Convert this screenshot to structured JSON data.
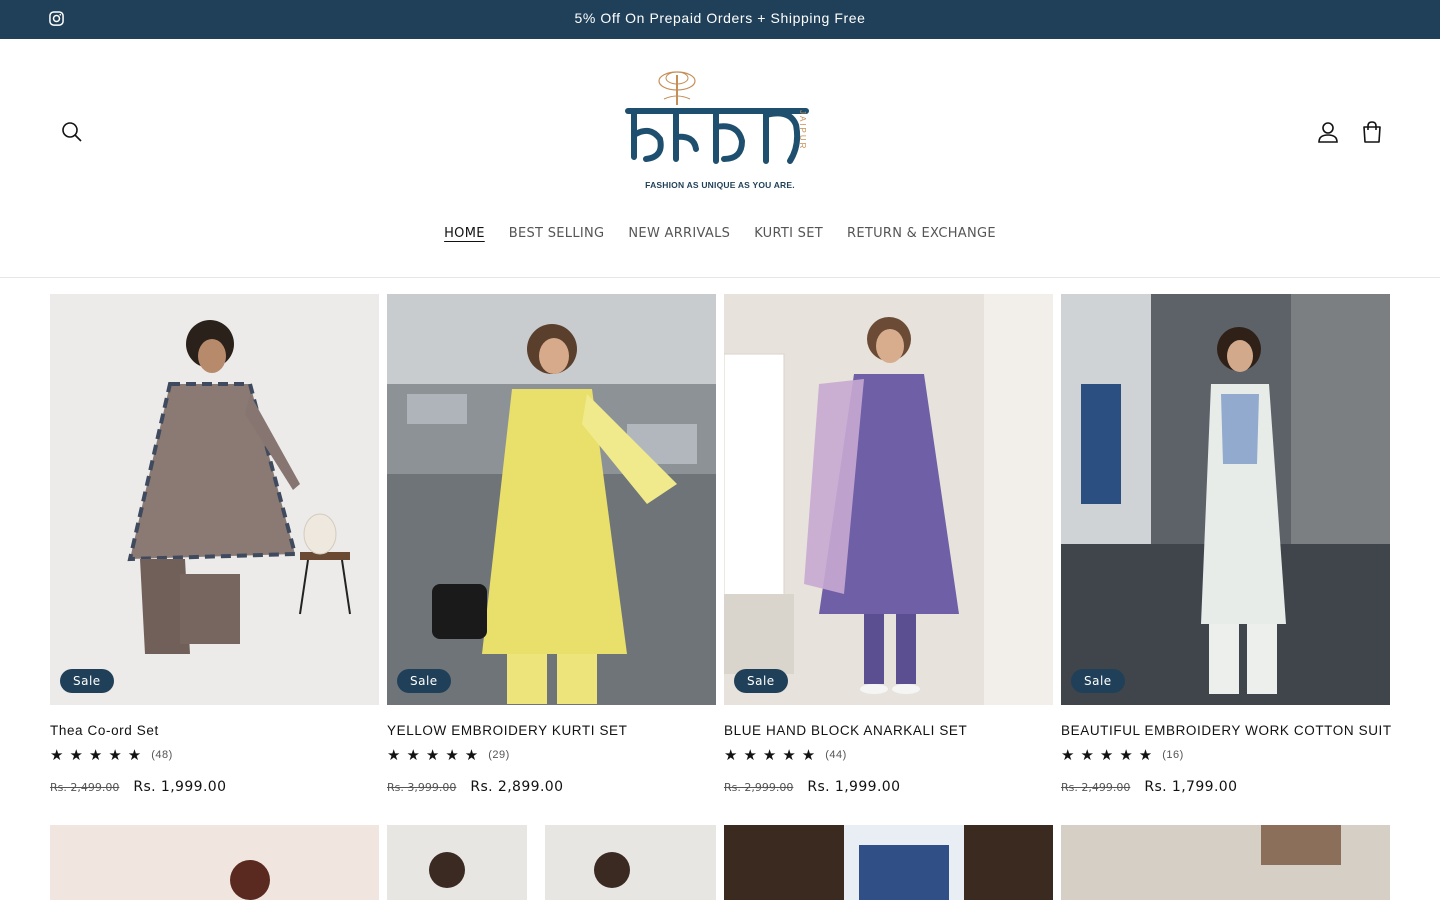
{
  "announcement": {
    "text": "5% Off On Prepaid Orders + Shipping Free",
    "social_icon": "instagram-icon"
  },
  "brand": {
    "logo_text": "बंधनी",
    "side_text": "JAIPUR",
    "tagline": "FASHION AS UNIQUE AS YOU ARE.",
    "colors": {
      "primary": "#1f4058",
      "accent": "#c58e56"
    }
  },
  "header_icons": {
    "search": "search-icon",
    "account": "user-icon",
    "cart": "cart-icon"
  },
  "nav": [
    {
      "label": "HOME",
      "active": true
    },
    {
      "label": "BEST SELLING"
    },
    {
      "label": "NEW ARRIVALS"
    },
    {
      "label": "KURTI SET"
    },
    {
      "label": "RETURN & EXCHANGE"
    }
  ],
  "products": [
    {
      "badge": "Sale",
      "title": "Thea Co-ord Set",
      "stars": "★★★★★",
      "reviews": "(48)",
      "old_price": "Rs. 2,499.00",
      "price": "Rs. 1,999.00"
    },
    {
      "badge": "Sale",
      "title": "YELLOW EMBROIDERY KURTI SET",
      "stars": "★★★★★",
      "reviews": "(29)",
      "old_price": "Rs. 3,999.00",
      "price": "Rs. 2,899.00"
    },
    {
      "badge": "Sale",
      "title": "BLUE HAND BLOCK ANARKALI SET",
      "stars": "★★★★★",
      "reviews": "(44)",
      "old_price": "Rs. 2,999.00",
      "price": "Rs. 1,999.00"
    },
    {
      "badge": "Sale",
      "title": "BEAUTIFUL EMBROIDERY WORK COTTON SUIT",
      "stars": "★★★★★",
      "reviews": "(16)",
      "old_price": "Rs. 2,499.00",
      "price": "Rs. 1,799.00"
    }
  ]
}
